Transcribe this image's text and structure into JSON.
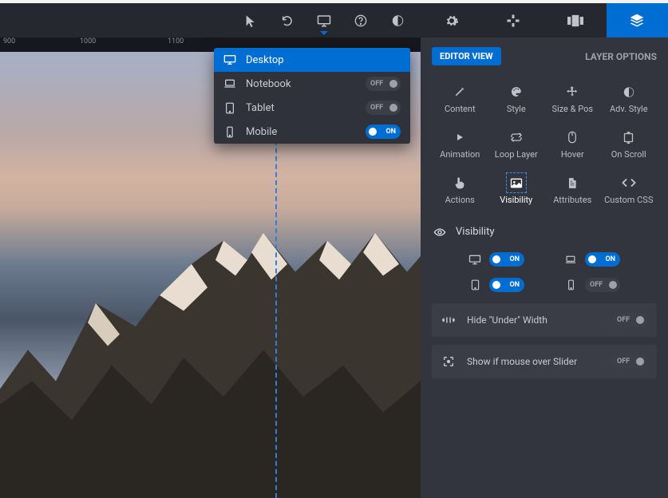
{
  "ruler": {
    "marks": [
      "900",
      "1000",
      "1100"
    ]
  },
  "dropdown": {
    "items": [
      {
        "label": "Desktop",
        "on": true,
        "selected": true,
        "icon": "desktop"
      },
      {
        "label": "Notebook",
        "on": false,
        "selected": false,
        "icon": "laptop"
      },
      {
        "label": "Tablet",
        "on": false,
        "selected": false,
        "icon": "tablet"
      },
      {
        "label": "Mobile",
        "on": true,
        "selected": false,
        "icon": "mobile"
      }
    ]
  },
  "toggle_text": {
    "on": "ON",
    "off": "OFF"
  },
  "panel": {
    "editor_view": "EDITOR VIEW",
    "layer_options": "LAYER OPTIONS",
    "grid": [
      {
        "label": "Content",
        "icon": "pencil"
      },
      {
        "label": "Style",
        "icon": "palette"
      },
      {
        "label": "Size & Pos",
        "icon": "move"
      },
      {
        "label": "Adv. Style",
        "icon": "contrast"
      },
      {
        "label": "Animation",
        "icon": "play"
      },
      {
        "label": "Loop Layer",
        "icon": "loop"
      },
      {
        "label": "Hover",
        "icon": "mouse"
      },
      {
        "label": "On Scroll",
        "icon": "scroll"
      },
      {
        "label": "Actions",
        "icon": "finger"
      },
      {
        "label": "Visibility",
        "icon": "image",
        "active": true
      },
      {
        "label": "Attributes",
        "icon": "file"
      },
      {
        "label": "Custom CSS",
        "icon": "code"
      }
    ],
    "section_title": "Visibility",
    "vis_toggles": [
      {
        "icon": "desktop",
        "on": true
      },
      {
        "icon": "laptop",
        "on": true
      },
      {
        "icon": "tablet",
        "on": true
      },
      {
        "icon": "mobile",
        "on": false
      }
    ],
    "options": [
      {
        "label": "Hide \"Under\" Width",
        "on": false,
        "icon": "arrows-h"
      },
      {
        "label": "Show if mouse over Slider",
        "on": false,
        "icon": "target"
      }
    ]
  }
}
